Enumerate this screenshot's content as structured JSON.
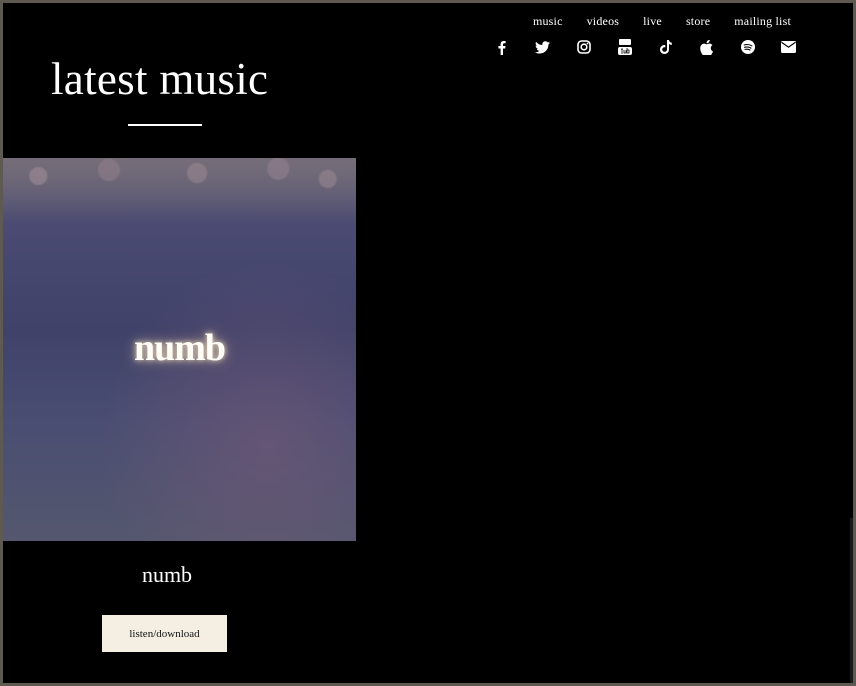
{
  "nav": {
    "items": [
      "music",
      "videos",
      "live",
      "store",
      "mailing list"
    ]
  },
  "social": {
    "icons": [
      "facebook-icon",
      "twitter-icon",
      "instagram-icon",
      "youtube-icon",
      "tiktok-icon",
      "apple-icon",
      "spotify-icon",
      "mail-icon"
    ]
  },
  "main": {
    "title": "latest music",
    "release": {
      "cover_text": "numb",
      "title": "numb",
      "button_label": "listen/download"
    }
  },
  "colors": {
    "background": "#000000",
    "text": "#ffffff",
    "button_bg": "#f5efe3"
  }
}
